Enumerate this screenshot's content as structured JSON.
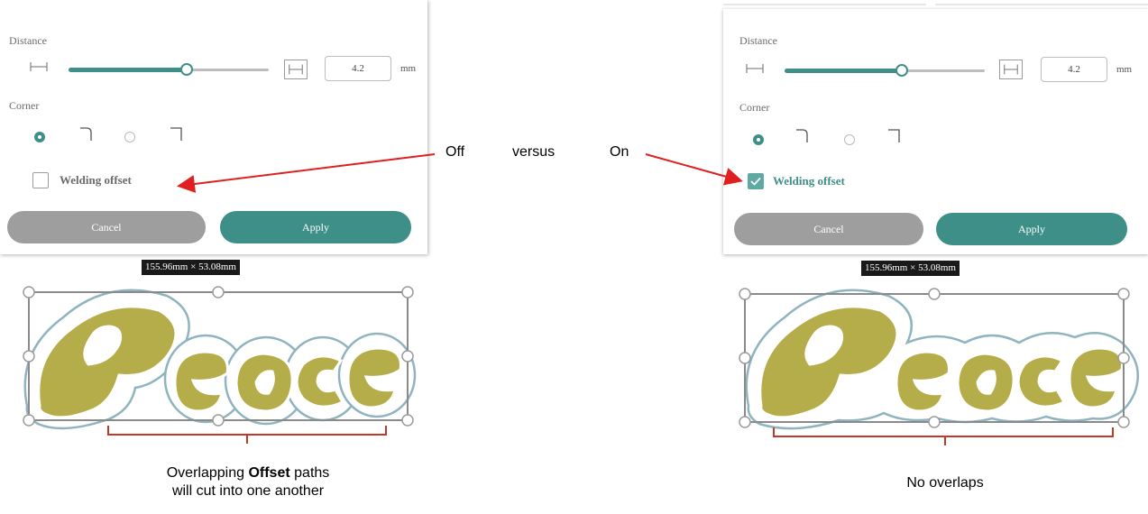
{
  "left_panel": {
    "distance_label": "Distance",
    "distance_value": "4.2",
    "distance_unit": "mm",
    "slider_level": 0.5,
    "corner_label": "Corner",
    "checkbox_label": "Welding offset",
    "checkbox_checked": false,
    "cancel_label": "Cancel",
    "apply_label": "Apply"
  },
  "right_panel": {
    "distance_label": "Distance",
    "distance_value": "4.2",
    "distance_unit": "mm",
    "slider_level": 0.5,
    "corner_label": "Corner",
    "checkbox_label": "Welding offset",
    "checkbox_checked": true,
    "cancel_label": "Cancel",
    "apply_label": "Apply"
  },
  "left_canvas": {
    "dimension_label": "155.96mm × 53.08mm",
    "artwork_text": "Peace"
  },
  "right_canvas": {
    "dimension_label": "155.96mm × 53.08mm",
    "artwork_text": "Peace"
  },
  "annotations": {
    "off": "Off",
    "versus": "versus",
    "on": "On",
    "left_caption_prefix": "Overlapping",
    "left_caption_bold": "Offset",
    "left_caption_suffix": "paths",
    "left_caption_line2": "will cut into one another",
    "right_caption": "No overlaps"
  },
  "colors": {
    "accent": "#3f8f89",
    "checkbox_checked": "#5fa9a3",
    "cancel_button": "#9e9e9e",
    "artwork_fill": "#b5ad4a",
    "offset_outline": "#8fb3bf",
    "annotation_red": "#e02020",
    "bracket_red": "#c0392b"
  },
  "icons": {
    "distance_min": "distance-min-icon",
    "distance_max": "distance-max-icon",
    "corner_round": "corner-round-icon",
    "corner_square": "corner-square-icon",
    "check": "check-icon"
  }
}
